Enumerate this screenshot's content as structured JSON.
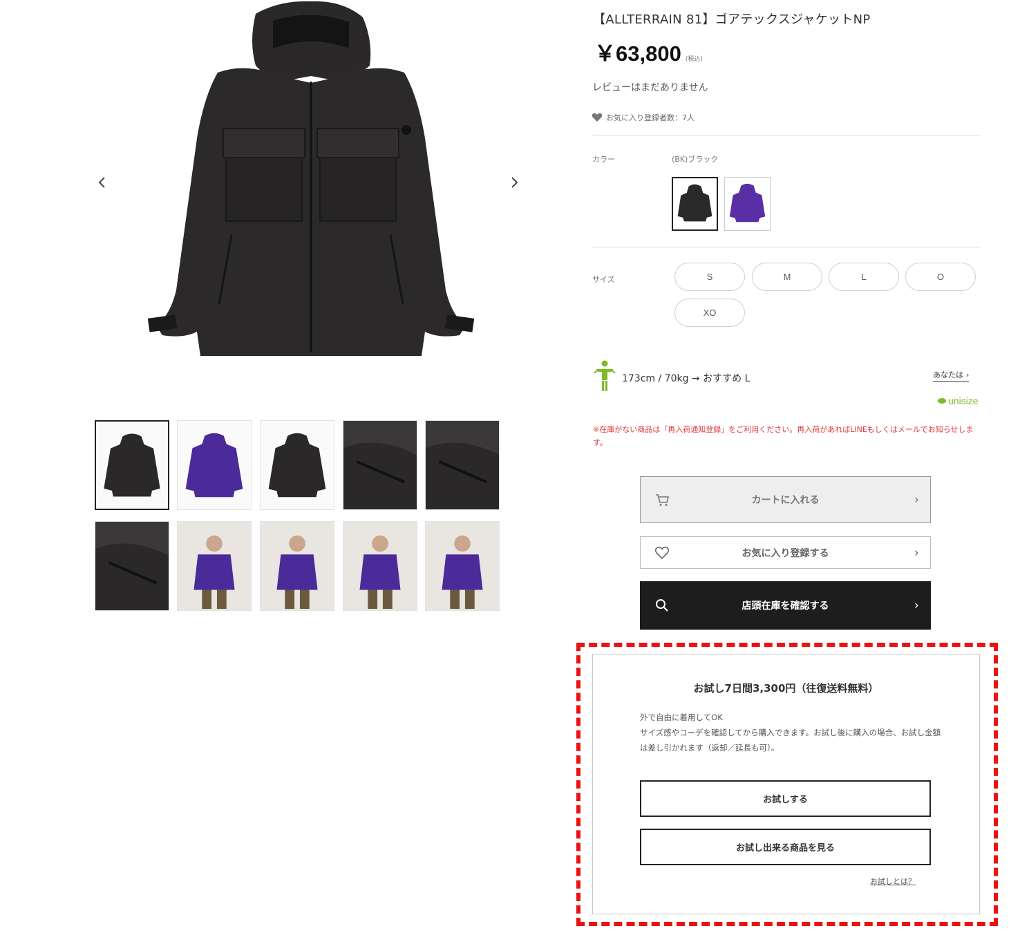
{
  "product": {
    "title": "【ALLTERRAIN 81】ゴアテックスジャケットNP",
    "price": "￥63,800",
    "tax_note": "(税込)",
    "reviews": "レビューはまだありません",
    "favorites": "お気に入り登録者数：7人"
  },
  "gallery": {
    "thumbnails": [
      {
        "color": "black",
        "kind": "front"
      },
      {
        "color": "purple",
        "kind": "front"
      },
      {
        "color": "black",
        "kind": "back"
      },
      {
        "color": "black",
        "kind": "detail"
      },
      {
        "color": "black",
        "kind": "lining"
      },
      {
        "color": "black",
        "kind": "sleeve"
      },
      {
        "color": "purple",
        "kind": "model-full"
      },
      {
        "color": "purple",
        "kind": "model-hood"
      },
      {
        "color": "purple",
        "kind": "model-close"
      },
      {
        "color": "purple",
        "kind": "model-side"
      }
    ]
  },
  "color": {
    "label": "カラー",
    "selected": "(BK)ブラック",
    "swatches": [
      {
        "name": "black",
        "hex": "#2a2a2a"
      },
      {
        "name": "purple",
        "hex": "#5a2fa6"
      }
    ]
  },
  "size": {
    "label": "サイズ",
    "options": [
      "S",
      "M",
      "L",
      "O",
      "XO"
    ]
  },
  "recommendation": {
    "text": "173cm / 70kg → おすすめ L",
    "link": "あなたは",
    "brand": "unisize"
  },
  "notice": "※在庫がない商品は「再入荷通知登録」をご利用ください。再入荷があればLINEもしくはメールでお知らせします。",
  "actions": {
    "cart": "カートに入れる",
    "favorite": "お気に入り登録する",
    "store": "店頭在庫を確認する"
  },
  "trial": {
    "title": "お試し7日間3,300円（往復送料無料）",
    "desc_line1": "外で自由に着用してOK",
    "desc_line2": "サイズ感やコーデを確認してから購入できます。お試し後に購入の場合、お試し金額は差し引かれます（返却／延長も可）。",
    "try_button": "お試しする",
    "browse_button": "お試し出来る商品を見る",
    "help_link": "お試しとは？"
  },
  "colors": {
    "accent_red": "#ee1111",
    "notice_red": "#e23b3b",
    "brand_green": "#7dbb2b",
    "dark_button": "#1d1d1d"
  }
}
